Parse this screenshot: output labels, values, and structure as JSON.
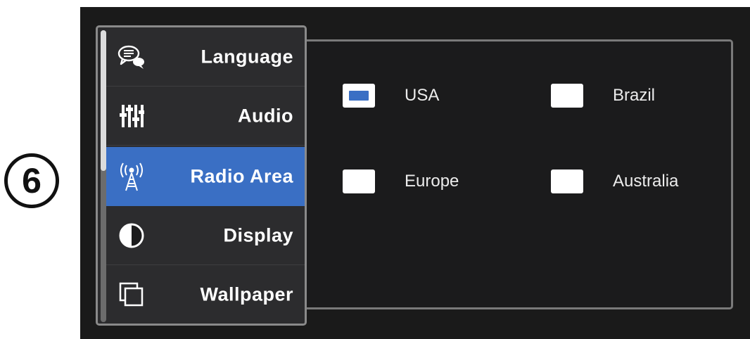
{
  "step_number": "6",
  "menu": {
    "items": [
      {
        "label": "Language",
        "icon": "chat-bubbles-icon",
        "active": false
      },
      {
        "label": "Audio",
        "icon": "equalizer-sliders-icon",
        "active": false
      },
      {
        "label": "Radio Area",
        "icon": "radio-tower-icon",
        "active": true
      },
      {
        "label": "Display",
        "icon": "contrast-circle-icon",
        "active": false
      },
      {
        "label": "Wallpaper",
        "icon": "stacked-windows-icon",
        "active": false
      }
    ]
  },
  "radio_area": {
    "options": [
      {
        "label": "USA",
        "selected": true
      },
      {
        "label": "Brazil",
        "selected": false
      },
      {
        "label": "Europe",
        "selected": false
      },
      {
        "label": "Australia",
        "selected": false
      }
    ]
  },
  "colors": {
    "accent": "#3a6fc4",
    "screen_background": "#1a1a1a",
    "menu_background": "#2c2c2e",
    "text": "#ffffff"
  }
}
